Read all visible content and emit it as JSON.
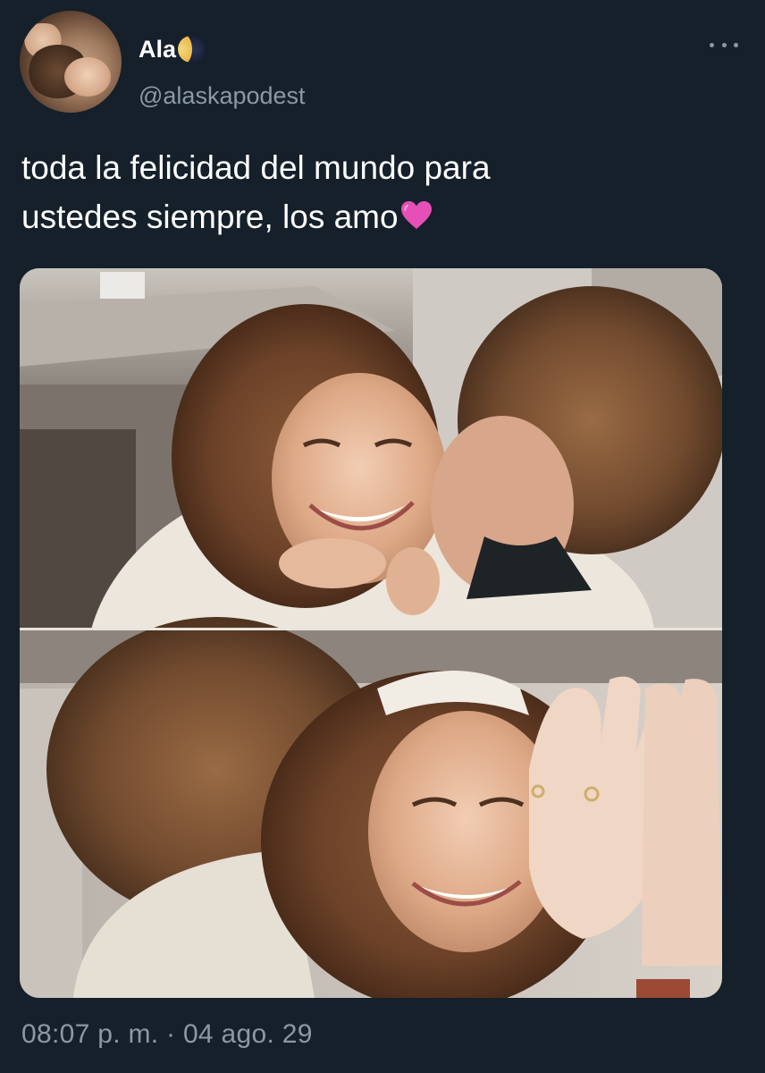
{
  "tweet": {
    "display_name": "Ala",
    "handle": "@alaskapodest",
    "text_line1": "toda la felicidad del mundo para",
    "text_line2": "ustedes siempre, los amo",
    "timestamp": "08:07 p. m. · 04 ago. 29"
  },
  "icons": {
    "name_emoji": "waning-crescent-moon-icon",
    "heart_emoji": "pink-heart-icon",
    "more": "more-options-icon"
  },
  "colors": {
    "background": "#15202b",
    "primary_text": "#ffffff",
    "secondary_text": "#8b98a5",
    "heart": "#e64fb6"
  }
}
